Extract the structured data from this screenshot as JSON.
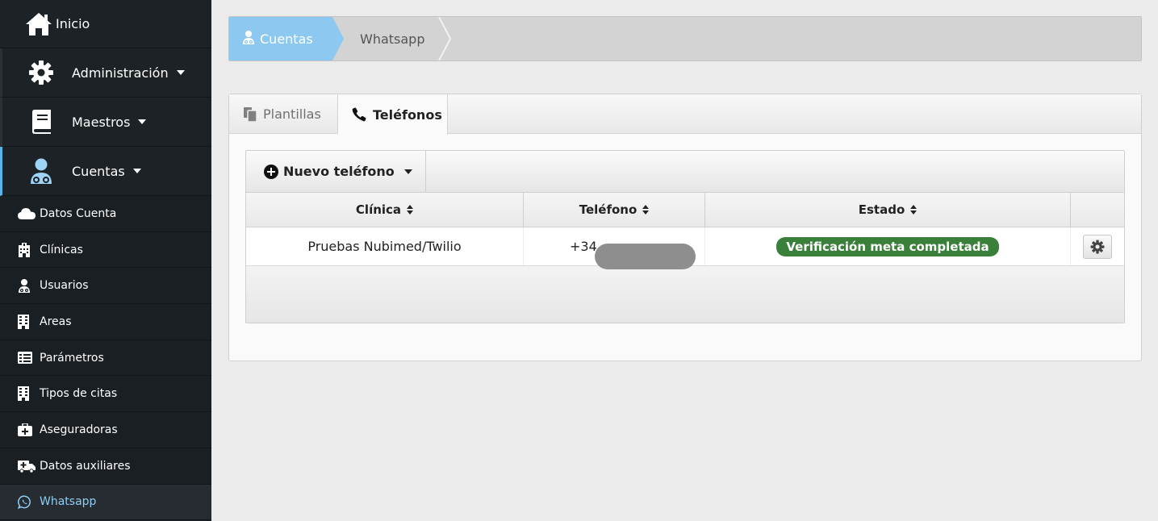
{
  "sidebar": {
    "inicio": {
      "label": "Inicio",
      "icon": "home-icon"
    },
    "groups": [
      {
        "label": "Administración",
        "icon": "gear-icon"
      },
      {
        "label": "Maestros",
        "icon": "book-icon"
      },
      {
        "label": "Cuentas",
        "icon": "user-doctor-icon"
      }
    ],
    "sub_items": [
      {
        "label": "Datos Cuenta",
        "icon": "cloud-icon"
      },
      {
        "label": "Clínicas",
        "icon": "hospital-icon"
      },
      {
        "label": "Usuarios",
        "icon": "user-doctor-icon"
      },
      {
        "label": "Areas",
        "icon": "building-icon"
      },
      {
        "label": "Parámetros",
        "icon": "list-icon"
      },
      {
        "label": "Tipos de citas",
        "icon": "building-icon"
      },
      {
        "label": "Aseguradoras",
        "icon": "medkit-icon"
      },
      {
        "label": "Datos auxiliares",
        "icon": "ambulance-icon"
      },
      {
        "label": "Whatsapp",
        "icon": "whatsapp-icon"
      }
    ],
    "active_color": "#5ab4e6"
  },
  "breadcrumb": {
    "active": "Cuentas",
    "current": "Whatsapp",
    "active_color": "#8cc8f0"
  },
  "tabs": [
    {
      "label": "Plantillas",
      "icon": "copy-icon"
    },
    {
      "label": "Teléfonos",
      "icon": "phone-icon"
    }
  ],
  "toolbar": {
    "new_label": "Nuevo teléfono"
  },
  "table": {
    "headers": [
      "Clínica",
      "Teléfono",
      "Estado",
      ""
    ],
    "rows": [
      {
        "clinica": "Pruebas Nubimed/Twilio",
        "telefono": "+34",
        "estado": "Verificación meta completada"
      }
    ],
    "status_color": "#3a7f3a"
  }
}
